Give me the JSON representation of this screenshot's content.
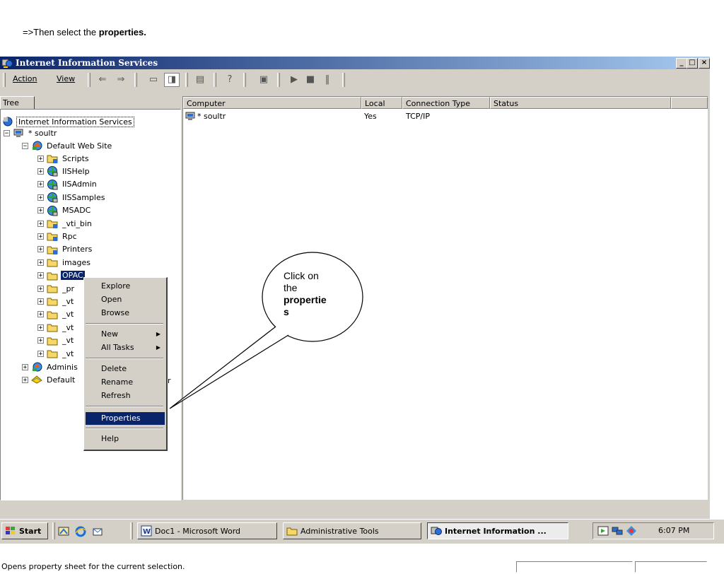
{
  "caption": {
    "prefix": "=>Then select the ",
    "bold": "properties."
  },
  "window": {
    "title": "Internet Information Services",
    "buttons": [
      "_",
      "□",
      "×"
    ]
  },
  "menu": {
    "action": "Action",
    "view": "View"
  },
  "toolbar": {
    "icons": [
      "back-icon",
      "forward-icon",
      "up-icon",
      "show-tree-icon",
      "export-icon",
      "help-icon",
      "computer-icon",
      "play-icon",
      "stop-icon",
      "pause-icon"
    ]
  },
  "tree": {
    "tab_label": "Tree",
    "root": "Internet Information Services",
    "server": "* soultr",
    "site": "Default Web Site",
    "children": [
      "Scripts",
      "IISHelp",
      "IISAdmin",
      "IISSamples",
      "MSADC",
      "_vti_bin",
      "Rpc",
      "Printers",
      "images",
      "OPAC",
      "_pr",
      "_vt",
      "_vt",
      "_vt",
      "_vt",
      "_vt"
    ],
    "admin_site": "Adminis",
    "default_ftp": "Default",
    "trailing_r": "r"
  },
  "list": {
    "columns": [
      "Computer",
      "Local",
      "Connection Type",
      "Status"
    ],
    "rows": [
      {
        "computer": "* soultr",
        "local": "Yes",
        "connection": "TCP/IP",
        "status": ""
      }
    ]
  },
  "context_menu": {
    "items": [
      "Explore",
      "Open",
      "Browse",
      "New",
      "All Tasks",
      "Delete",
      "Rename",
      "Refresh",
      "Properties",
      "Help"
    ],
    "highlighted": "Properties"
  },
  "callout": {
    "line1": "Click on",
    "line2": "the",
    "line3": "propertie",
    "line4": "s"
  },
  "status": {
    "text": "Opens property sheet for the current selection."
  },
  "taskbar": {
    "start": "Start",
    "tasks": [
      "Doc1 - Microsoft Word",
      "Administrative Tools",
      "Internet Information ..."
    ],
    "clock": "6:07 PM"
  },
  "colors": {
    "title_start": "#0a246a",
    "title_end": "#a6caf0",
    "selection": "#0a246a",
    "face": "#d4d0c8"
  }
}
